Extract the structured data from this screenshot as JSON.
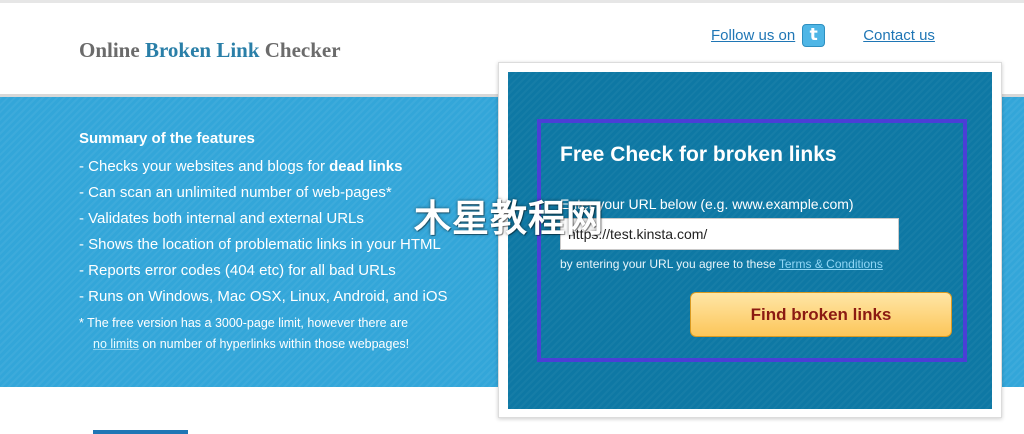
{
  "header": {
    "logo_part1": "Online ",
    "logo_part2": "Broken Link",
    "logo_part3": " Checker",
    "follow_label": "Follow us on",
    "twitter_icon": "twitter-icon",
    "twitter_glyph": "t",
    "contact_label": "Contact us"
  },
  "features": {
    "title": "Summary of the features",
    "items": [
      {
        "pre": "- Checks your websites and blogs for ",
        "bold": "dead links",
        "post": ""
      },
      {
        "pre": "- Can scan an unlimited number of web-pages*",
        "bold": "",
        "post": ""
      },
      {
        "pre": "- Validates both internal and external URLs",
        "bold": "",
        "post": ""
      },
      {
        "pre": "- Shows the location of problematic links in your HTML",
        "bold": "",
        "post": ""
      },
      {
        "pre": "- Reports error codes (404 etc) for all bad URLs",
        "bold": "",
        "post": ""
      },
      {
        "pre": "- Runs on Windows, Mac OSX, Linux, Android, and iOS",
        "bold": "",
        "post": ""
      }
    ],
    "footnote_line1": "*  The free version has a 3000-page limit, however there are",
    "footnote_hl": "no limits",
    "footnote_line2_rest": " on number of hyperlinks within those webpages!"
  },
  "check": {
    "title": "Free Check for broken links",
    "label": "Enter your URL below (e.g. www.example.com)",
    "url_value": "https://test.kinsta.com/",
    "agree_text": "by entering your URL you agree to these ",
    "terms_link": "Terms & Conditions",
    "button_label": "Find broken links"
  },
  "watermark": {
    "text": "木星教程网"
  },
  "colors": {
    "band": "#33a6d9",
    "panel": "#0e78a4",
    "highlight_frame": "#4b3fd6",
    "button_text": "#8b1a12",
    "link": "#1f76b5"
  }
}
